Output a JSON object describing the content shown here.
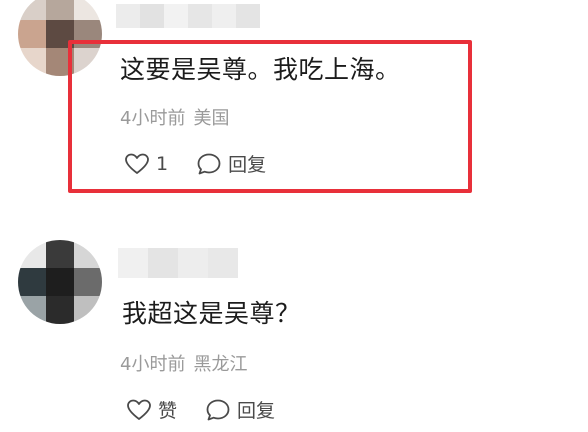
{
  "comments": [
    {
      "text": "这要是吴尊。我吃上海。",
      "time": "4小时前",
      "location": "美国",
      "like_count": "1",
      "reply_label": "回复"
    },
    {
      "text": "我超这是吴尊？",
      "time": "4小时前",
      "location": "黑龙江",
      "like_label": "赞",
      "reply_label": "回复"
    }
  ],
  "colors": {
    "highlight_border": "#e8303a",
    "meta_text": "#9a9a9a"
  },
  "icons": [
    "heart-outline-icon",
    "speech-bubble-icon"
  ]
}
